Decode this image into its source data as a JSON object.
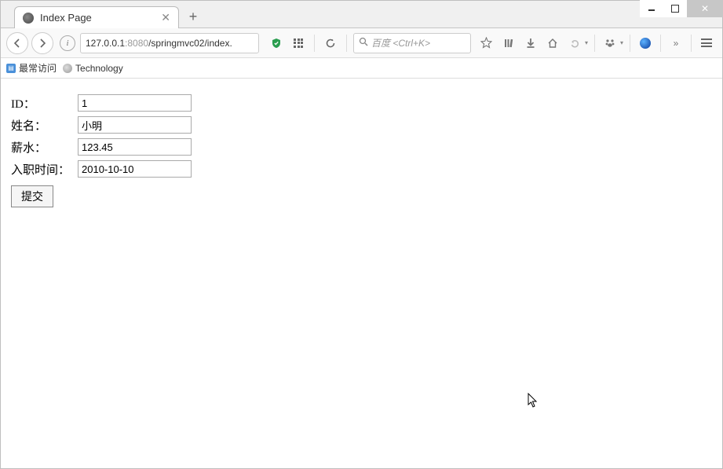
{
  "window": {
    "tab_title": "Index Page"
  },
  "nav": {
    "url_host": "127.0.0.1",
    "url_port": ":8080",
    "url_path": "/springmvc02/index.",
    "search_placeholder": "百度 <Ctrl+K>"
  },
  "bookmarks": {
    "most_visited": "最常访问",
    "technology": "Technology"
  },
  "form": {
    "id_label": "ID：",
    "id_value": "1",
    "name_label": "姓名：",
    "name_value": "小明",
    "salary_label": "薪水：",
    "salary_value": "123.45",
    "hiredate_label": "入职时间：",
    "hiredate_value": "2010-10-10",
    "submit_label": "提交"
  }
}
